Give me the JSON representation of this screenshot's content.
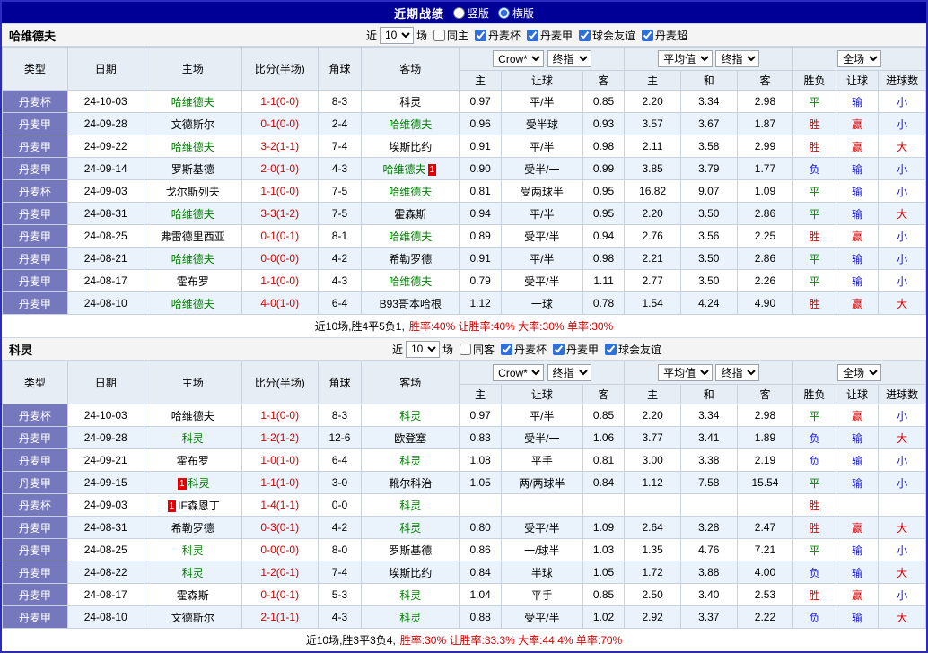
{
  "topbar": {
    "title": "近期战绩",
    "layout_options": [
      {
        "label": "竖版",
        "selected": false
      },
      {
        "label": "横版",
        "selected": true
      }
    ]
  },
  "sections": [
    {
      "team": "哈维德夫",
      "filters": {
        "near_label": "近",
        "count": "10",
        "games_label": "场",
        "same": {
          "label": "同主",
          "checked": false
        },
        "leagues": [
          {
            "label": "丹麦杯",
            "checked": true
          },
          {
            "label": "丹麦甲",
            "checked": true
          },
          {
            "label": "球会友谊",
            "checked": true
          },
          {
            "label": "丹麦超",
            "checked": true
          }
        ]
      },
      "header": {
        "col_type": "类型",
        "col_date": "日期",
        "col_home": "主场",
        "col_score": "比分(半场)",
        "col_corner": "角球",
        "col_away": "客场",
        "bookmaker": "Crow*",
        "final1": "终指",
        "avg": "平均值",
        "final2": "终指",
        "fulltime": "全场",
        "sub": [
          "主",
          "让球",
          "客",
          "主",
          "和",
          "客",
          "胜负",
          "让球",
          "进球数"
        ]
      },
      "rows": [
        {
          "type": "丹麦杯",
          "date": "24-10-03",
          "home": {
            "text": "哈维德夫",
            "focal": true
          },
          "score": "1-1(0-0)",
          "corner": "8-3",
          "away": {
            "text": "科灵",
            "focal": false
          },
          "odds": [
            "0.97",
            "平/半",
            "0.85",
            "2.20",
            "3.34",
            "2.98"
          ],
          "results": [
            [
              "平",
              "draw"
            ],
            [
              "输",
              "lose"
            ],
            [
              "小",
              "lose"
            ]
          ]
        },
        {
          "type": "丹麦甲",
          "date": "24-09-28",
          "home": {
            "text": "文德斯尔",
            "focal": false
          },
          "score": "0-1(0-0)",
          "corner": "2-4",
          "away": {
            "text": "哈维德夫",
            "focal": true
          },
          "odds": [
            "0.96",
            "受半球",
            "0.93",
            "3.57",
            "3.67",
            "1.87"
          ],
          "results": [
            [
              "胜",
              "win"
            ],
            [
              "赢",
              "win"
            ],
            [
              "小",
              "lose"
            ]
          ]
        },
        {
          "type": "丹麦甲",
          "date": "24-09-22",
          "home": {
            "text": "哈维德夫",
            "focal": true
          },
          "score": "3-2(1-1)",
          "corner": "7-4",
          "away": {
            "text": "埃斯比约",
            "focal": false
          },
          "odds": [
            "0.91",
            "平/半",
            "0.98",
            "2.11",
            "3.58",
            "2.99"
          ],
          "results": [
            [
              "胜",
              "win"
            ],
            [
              "赢",
              "win"
            ],
            [
              "大",
              "win"
            ]
          ]
        },
        {
          "type": "丹麦甲",
          "date": "24-09-14",
          "home": {
            "text": "罗斯基德",
            "focal": false
          },
          "score": "2-0(1-0)",
          "corner": "4-3",
          "away": {
            "text": "哈维德夫",
            "focal": true,
            "badge": "1",
            "badge_pos": "after"
          },
          "odds": [
            "0.90",
            "受半/一",
            "0.99",
            "3.85",
            "3.79",
            "1.77"
          ],
          "results": [
            [
              "负",
              "lose"
            ],
            [
              "输",
              "lose"
            ],
            [
              "小",
              "lose"
            ]
          ]
        },
        {
          "type": "丹麦杯",
          "date": "24-09-03",
          "home": {
            "text": "戈尔斯列夫",
            "focal": false
          },
          "score": "1-1(0-0)",
          "corner": "7-5",
          "away": {
            "text": "哈维德夫",
            "focal": true
          },
          "odds": [
            "0.81",
            "受两球半",
            "0.95",
            "16.82",
            "9.07",
            "1.09"
          ],
          "results": [
            [
              "平",
              "draw"
            ],
            [
              "输",
              "lose"
            ],
            [
              "小",
              "lose"
            ]
          ]
        },
        {
          "type": "丹麦甲",
          "date": "24-08-31",
          "home": {
            "text": "哈维德夫",
            "focal": true
          },
          "score": "3-3(1-2)",
          "corner": "7-5",
          "away": {
            "text": "霍森斯",
            "focal": false
          },
          "odds": [
            "0.94",
            "平/半",
            "0.95",
            "2.20",
            "3.50",
            "2.86"
          ],
          "results": [
            [
              "平",
              "draw"
            ],
            [
              "输",
              "lose"
            ],
            [
              "大",
              "win"
            ]
          ]
        },
        {
          "type": "丹麦甲",
          "date": "24-08-25",
          "home": {
            "text": "弗雷德里西亚",
            "focal": false
          },
          "score": "0-1(0-1)",
          "corner": "8-1",
          "away": {
            "text": "哈维德夫",
            "focal": true
          },
          "odds": [
            "0.89",
            "受平/半",
            "0.94",
            "2.76",
            "3.56",
            "2.25"
          ],
          "results": [
            [
              "胜",
              "win"
            ],
            [
              "赢",
              "win"
            ],
            [
              "小",
              "lose"
            ]
          ]
        },
        {
          "type": "丹麦甲",
          "date": "24-08-21",
          "home": {
            "text": "哈维德夫",
            "focal": true
          },
          "score": "0-0(0-0)",
          "corner": "4-2",
          "away": {
            "text": "希勒罗德",
            "focal": false
          },
          "odds": [
            "0.91",
            "平/半",
            "0.98",
            "2.21",
            "3.50",
            "2.86"
          ],
          "results": [
            [
              "平",
              "draw"
            ],
            [
              "输",
              "lose"
            ],
            [
              "小",
              "lose"
            ]
          ]
        },
        {
          "type": "丹麦甲",
          "date": "24-08-17",
          "home": {
            "text": "霍布罗",
            "focal": false
          },
          "score": "1-1(0-0)",
          "corner": "4-3",
          "away": {
            "text": "哈维德夫",
            "focal": true
          },
          "odds": [
            "0.79",
            "受平/半",
            "1.11",
            "2.77",
            "3.50",
            "2.26"
          ],
          "results": [
            [
              "平",
              "draw"
            ],
            [
              "输",
              "lose"
            ],
            [
              "小",
              "lose"
            ]
          ]
        },
        {
          "type": "丹麦甲",
          "date": "24-08-10",
          "home": {
            "text": "哈维德夫",
            "focal": true
          },
          "score": "4-0(1-0)",
          "corner": "6-4",
          "away": {
            "text": "B93哥本哈根",
            "focal": false
          },
          "odds": [
            "1.12",
            "一球",
            "0.78",
            "1.54",
            "4.24",
            "4.90"
          ],
          "results": [
            [
              "胜",
              "win"
            ],
            [
              "赢",
              "win"
            ],
            [
              "大",
              "win"
            ]
          ]
        }
      ],
      "summary": {
        "record": "近10场,胜4平5负1,",
        "rates": "胜率:40% 让胜率:40% 大率:30% 单率:30%"
      }
    },
    {
      "team": "科灵",
      "filters": {
        "near_label": "近",
        "count": "10",
        "games_label": "场",
        "same": {
          "label": "同客",
          "checked": false
        },
        "leagues": [
          {
            "label": "丹麦杯",
            "checked": true
          },
          {
            "label": "丹麦甲",
            "checked": true
          },
          {
            "label": "球会友谊",
            "checked": true
          }
        ]
      },
      "header": {
        "col_type": "类型",
        "col_date": "日期",
        "col_home": "主场",
        "col_score": "比分(半场)",
        "col_corner": "角球",
        "col_away": "客场",
        "bookmaker": "Crow*",
        "final1": "终指",
        "avg": "平均值",
        "final2": "终指",
        "fulltime": "全场",
        "sub": [
          "主",
          "让球",
          "客",
          "主",
          "和",
          "客",
          "胜负",
          "让球",
          "进球数"
        ]
      },
      "rows": [
        {
          "type": "丹麦杯",
          "date": "24-10-03",
          "home": {
            "text": "哈维德夫",
            "focal": false
          },
          "score": "1-1(0-0)",
          "corner": "8-3",
          "away": {
            "text": "科灵",
            "focal": true
          },
          "odds": [
            "0.97",
            "平/半",
            "0.85",
            "2.20",
            "3.34",
            "2.98"
          ],
          "results": [
            [
              "平",
              "draw"
            ],
            [
              "赢",
              "win"
            ],
            [
              "小",
              "lose"
            ]
          ]
        },
        {
          "type": "丹麦甲",
          "date": "24-09-28",
          "home": {
            "text": "科灵",
            "focal": true
          },
          "score": "1-2(1-2)",
          "corner": "12-6",
          "away": {
            "text": "欧登塞",
            "focal": false
          },
          "odds": [
            "0.83",
            "受半/一",
            "1.06",
            "3.77",
            "3.41",
            "1.89"
          ],
          "results": [
            [
              "负",
              "lose"
            ],
            [
              "输",
              "lose"
            ],
            [
              "大",
              "win"
            ]
          ]
        },
        {
          "type": "丹麦甲",
          "date": "24-09-21",
          "home": {
            "text": "霍布罗",
            "focal": false
          },
          "score": "1-0(1-0)",
          "corner": "6-4",
          "away": {
            "text": "科灵",
            "focal": true
          },
          "odds": [
            "1.08",
            "平手",
            "0.81",
            "3.00",
            "3.38",
            "2.19"
          ],
          "results": [
            [
              "负",
              "lose"
            ],
            [
              "输",
              "lose"
            ],
            [
              "小",
              "lose"
            ]
          ]
        },
        {
          "type": "丹麦甲",
          "date": "24-09-15",
          "home": {
            "text": "科灵",
            "focal": true,
            "badge": "1",
            "badge_pos": "before"
          },
          "score": "1-1(1-0)",
          "corner": "3-0",
          "away": {
            "text": "靴尔科治",
            "focal": false
          },
          "odds": [
            "1.05",
            "两/两球半",
            "0.84",
            "1.12",
            "7.58",
            "15.54"
          ],
          "results": [
            [
              "平",
              "draw"
            ],
            [
              "输",
              "lose"
            ],
            [
              "小",
              "lose"
            ]
          ]
        },
        {
          "type": "丹麦杯",
          "date": "24-09-03",
          "home": {
            "text": "IF森恩丁",
            "focal": false,
            "badge": "1",
            "badge_pos": "before"
          },
          "score": "1-4(1-1)",
          "corner": "0-0",
          "away": {
            "text": "科灵",
            "focal": true
          },
          "odds": [
            "",
            "",
            "",
            "",
            "",
            ""
          ],
          "results": [
            [
              "胜",
              "win"
            ],
            [
              "",
              ""
            ],
            [
              "",
              ""
            ]
          ]
        },
        {
          "type": "丹麦甲",
          "date": "24-08-31",
          "home": {
            "text": "希勒罗德",
            "focal": false
          },
          "score": "0-3(0-1)",
          "corner": "4-2",
          "away": {
            "text": "科灵",
            "focal": true
          },
          "odds": [
            "0.80",
            "受平/半",
            "1.09",
            "2.64",
            "3.28",
            "2.47"
          ],
          "results": [
            [
              "胜",
              "win"
            ],
            [
              "赢",
              "win"
            ],
            [
              "大",
              "win"
            ]
          ]
        },
        {
          "type": "丹麦甲",
          "date": "24-08-25",
          "home": {
            "text": "科灵",
            "focal": true
          },
          "score": "0-0(0-0)",
          "corner": "8-0",
          "away": {
            "text": "罗斯基德",
            "focal": false
          },
          "odds": [
            "0.86",
            "一/球半",
            "1.03",
            "1.35",
            "4.76",
            "7.21"
          ],
          "results": [
            [
              "平",
              "draw"
            ],
            [
              "输",
              "lose"
            ],
            [
              "小",
              "lose"
            ]
          ]
        },
        {
          "type": "丹麦甲",
          "date": "24-08-22",
          "home": {
            "text": "科灵",
            "focal": true
          },
          "score": "1-2(0-1)",
          "corner": "7-4",
          "away": {
            "text": "埃斯比约",
            "focal": false
          },
          "odds": [
            "0.84",
            "半球",
            "1.05",
            "1.72",
            "3.88",
            "4.00"
          ],
          "results": [
            [
              "负",
              "lose"
            ],
            [
              "输",
              "lose"
            ],
            [
              "大",
              "win"
            ]
          ]
        },
        {
          "type": "丹麦甲",
          "date": "24-08-17",
          "home": {
            "text": "霍森斯",
            "focal": false
          },
          "score": "0-1(0-1)",
          "corner": "5-3",
          "away": {
            "text": "科灵",
            "focal": true
          },
          "odds": [
            "1.04",
            "平手",
            "0.85",
            "2.50",
            "3.40",
            "2.53"
          ],
          "results": [
            [
              "胜",
              "win"
            ],
            [
              "赢",
              "win"
            ],
            [
              "小",
              "lose"
            ]
          ]
        },
        {
          "type": "丹麦甲",
          "date": "24-08-10",
          "home": {
            "text": "文德斯尔",
            "focal": false
          },
          "score": "2-1(1-1)",
          "corner": "4-3",
          "away": {
            "text": "科灵",
            "focal": true
          },
          "odds": [
            "0.88",
            "受平/半",
            "1.02",
            "2.92",
            "3.37",
            "2.22"
          ],
          "results": [
            [
              "负",
              "lose"
            ],
            [
              "输",
              "lose"
            ],
            [
              "大",
              "win"
            ]
          ]
        }
      ],
      "summary": {
        "record": "近10场,胜3平3负4,",
        "rates": "胜率:30% 让胜率:33.3% 大率:44.4% 单率:70%"
      }
    }
  ]
}
